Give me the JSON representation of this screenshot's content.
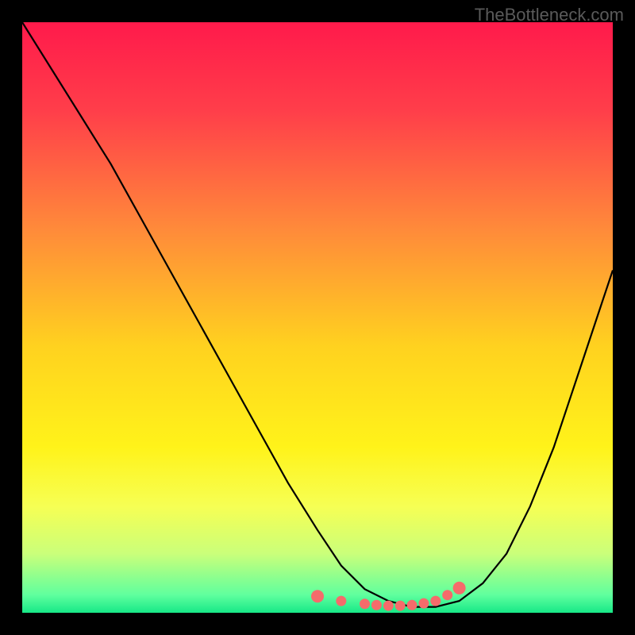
{
  "watermark": "TheBottleneck.com",
  "chart_data": {
    "type": "line",
    "title": "",
    "xlabel": "",
    "ylabel": "",
    "xlim": [
      0,
      100
    ],
    "ylim": [
      0,
      100
    ],
    "series": [
      {
        "name": "bottleneck-curve",
        "x": [
          0,
          5,
          10,
          15,
          20,
          25,
          30,
          35,
          40,
          45,
          50,
          54,
          58,
          62,
          66,
          70,
          74,
          78,
          82,
          86,
          90,
          94,
          98,
          100
        ],
        "y": [
          100,
          92,
          84,
          76,
          67,
          58,
          49,
          40,
          31,
          22,
          14,
          8,
          4,
          2,
          1,
          1,
          2,
          5,
          10,
          18,
          28,
          40,
          52,
          58
        ]
      }
    ],
    "markers": {
      "name": "highlight-dots",
      "color": "#f56b6b",
      "x": [
        50,
        54,
        58,
        60,
        62,
        64,
        66,
        68,
        70,
        72,
        74
      ],
      "y": [
        2.8,
        2.0,
        1.5,
        1.3,
        1.2,
        1.2,
        1.3,
        1.6,
        2.0,
        3.0,
        4.2
      ]
    },
    "background_gradient": {
      "stops": [
        {
          "offset": 0.0,
          "color": "#ff1a4b"
        },
        {
          "offset": 0.15,
          "color": "#ff3e4a"
        },
        {
          "offset": 0.35,
          "color": "#ff8a3a"
        },
        {
          "offset": 0.55,
          "color": "#ffd21f"
        },
        {
          "offset": 0.72,
          "color": "#fff31a"
        },
        {
          "offset": 0.82,
          "color": "#f6ff54"
        },
        {
          "offset": 0.9,
          "color": "#caff7a"
        },
        {
          "offset": 0.97,
          "color": "#5fff9e"
        },
        {
          "offset": 1.0,
          "color": "#17e887"
        }
      ]
    }
  }
}
